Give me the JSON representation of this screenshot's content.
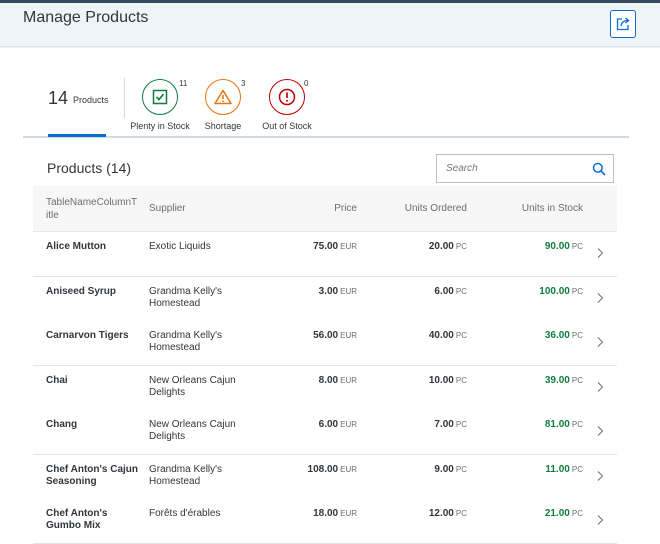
{
  "page": {
    "title": "Manage Products",
    "share_icon": "share-icon"
  },
  "tabbar": {
    "all": {
      "count": "14",
      "label": "Products"
    },
    "filters": [
      {
        "key": "plenty",
        "label": "Plenty in Stock",
        "count": "11",
        "icon": "checkbox-icon",
        "color": "#107e3e"
      },
      {
        "key": "shortage",
        "label": "Shortage",
        "count": "3",
        "icon": "warning-icon",
        "color": "#e9730c"
      },
      {
        "key": "out",
        "label": "Out of Stock",
        "count": "0",
        "icon": "error-icon",
        "color": "#bb0000"
      }
    ]
  },
  "table": {
    "title": "Products (14)",
    "search": {
      "placeholder": "Search",
      "value": ""
    },
    "columns": {
      "name": "TableNameColumnT\nitle",
      "supplier": "Supplier",
      "price": "Price",
      "ordered": "Units Ordered",
      "stock": "Units in Stock"
    },
    "rows": [
      {
        "name": "Alice Mutton",
        "supplier": "Exotic Liquids",
        "price": "75.00",
        "price_unit": "EUR",
        "ordered": "20.00",
        "ordered_unit": "PC",
        "stock": "90.00",
        "stock_unit": "PC"
      },
      {
        "name": "Aniseed Syrup",
        "supplier": "Grandma Kelly's Homestead",
        "price": "3.00",
        "price_unit": "EUR",
        "ordered": "6.00",
        "ordered_unit": "PC",
        "stock": "100.00",
        "stock_unit": "PC"
      },
      {
        "name": "Carnarvon Tigers",
        "supplier": "Grandma Kelly's Homestead",
        "price": "56.00",
        "price_unit": "EUR",
        "ordered": "40.00",
        "ordered_unit": "PC",
        "stock": "36.00",
        "stock_unit": "PC"
      },
      {
        "name": "Chai",
        "supplier": "New Orleans Cajun Delights",
        "price": "8.00",
        "price_unit": "EUR",
        "ordered": "10.00",
        "ordered_unit": "PC",
        "stock": "39.00",
        "stock_unit": "PC"
      },
      {
        "name": "Chang",
        "supplier": "New Orleans Cajun Delights",
        "price": "6.00",
        "price_unit": "EUR",
        "ordered": "7.00",
        "ordered_unit": "PC",
        "stock": "81.00",
        "stock_unit": "PC"
      },
      {
        "name": "Chef Anton's Cajun Seasoning",
        "supplier": "Grandma Kelly's Homestead",
        "price": "108.00",
        "price_unit": "EUR",
        "ordered": "9.00",
        "ordered_unit": "PC",
        "stock": "11.00",
        "stock_unit": "PC"
      },
      {
        "name": "Chef Anton's Gumbo Mix",
        "supplier": "Forêts d'érables",
        "price": "18.00",
        "price_unit": "EUR",
        "ordered": "12.00",
        "ordered_unit": "PC",
        "stock": "21.00",
        "stock_unit": "PC"
      }
    ]
  }
}
